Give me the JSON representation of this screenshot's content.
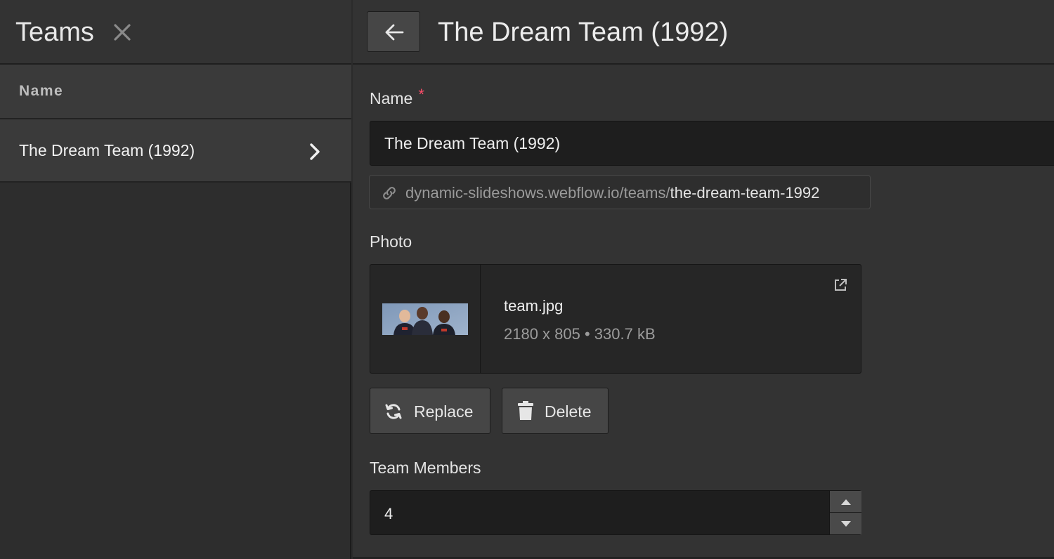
{
  "left_panel": {
    "title": "Teams",
    "column_header": "Name",
    "items": [
      {
        "label": "The Dream Team (1992)"
      }
    ]
  },
  "editor": {
    "title": "The Dream Team (1992)",
    "fields": {
      "name": {
        "label": "Name",
        "required_mark": "*",
        "value": "The Dream Team (1992)"
      },
      "slug": {
        "base": "dynamic-slideshows.webflow.io/teams/",
        "value": "the-dream-team-1992"
      },
      "photo": {
        "label": "Photo",
        "file_name": "team.jpg",
        "file_meta": "2180 x 805 • 330.7 kB",
        "replace_label": "Replace",
        "delete_label": "Delete"
      },
      "team_members": {
        "label": "Team Members",
        "value": "4"
      }
    }
  },
  "colors": {
    "background": "#333333",
    "sidebar": "#2d2d2d",
    "input_bg": "#1e1e1e",
    "required_accent": "#ff4d6a",
    "button_bg": "#464646"
  },
  "icons": [
    "close-icon",
    "chevron-right-icon",
    "arrow-left-icon",
    "link-icon",
    "external-link-icon",
    "refresh-icon",
    "trash-icon",
    "caret-up-icon",
    "caret-down-icon"
  ]
}
